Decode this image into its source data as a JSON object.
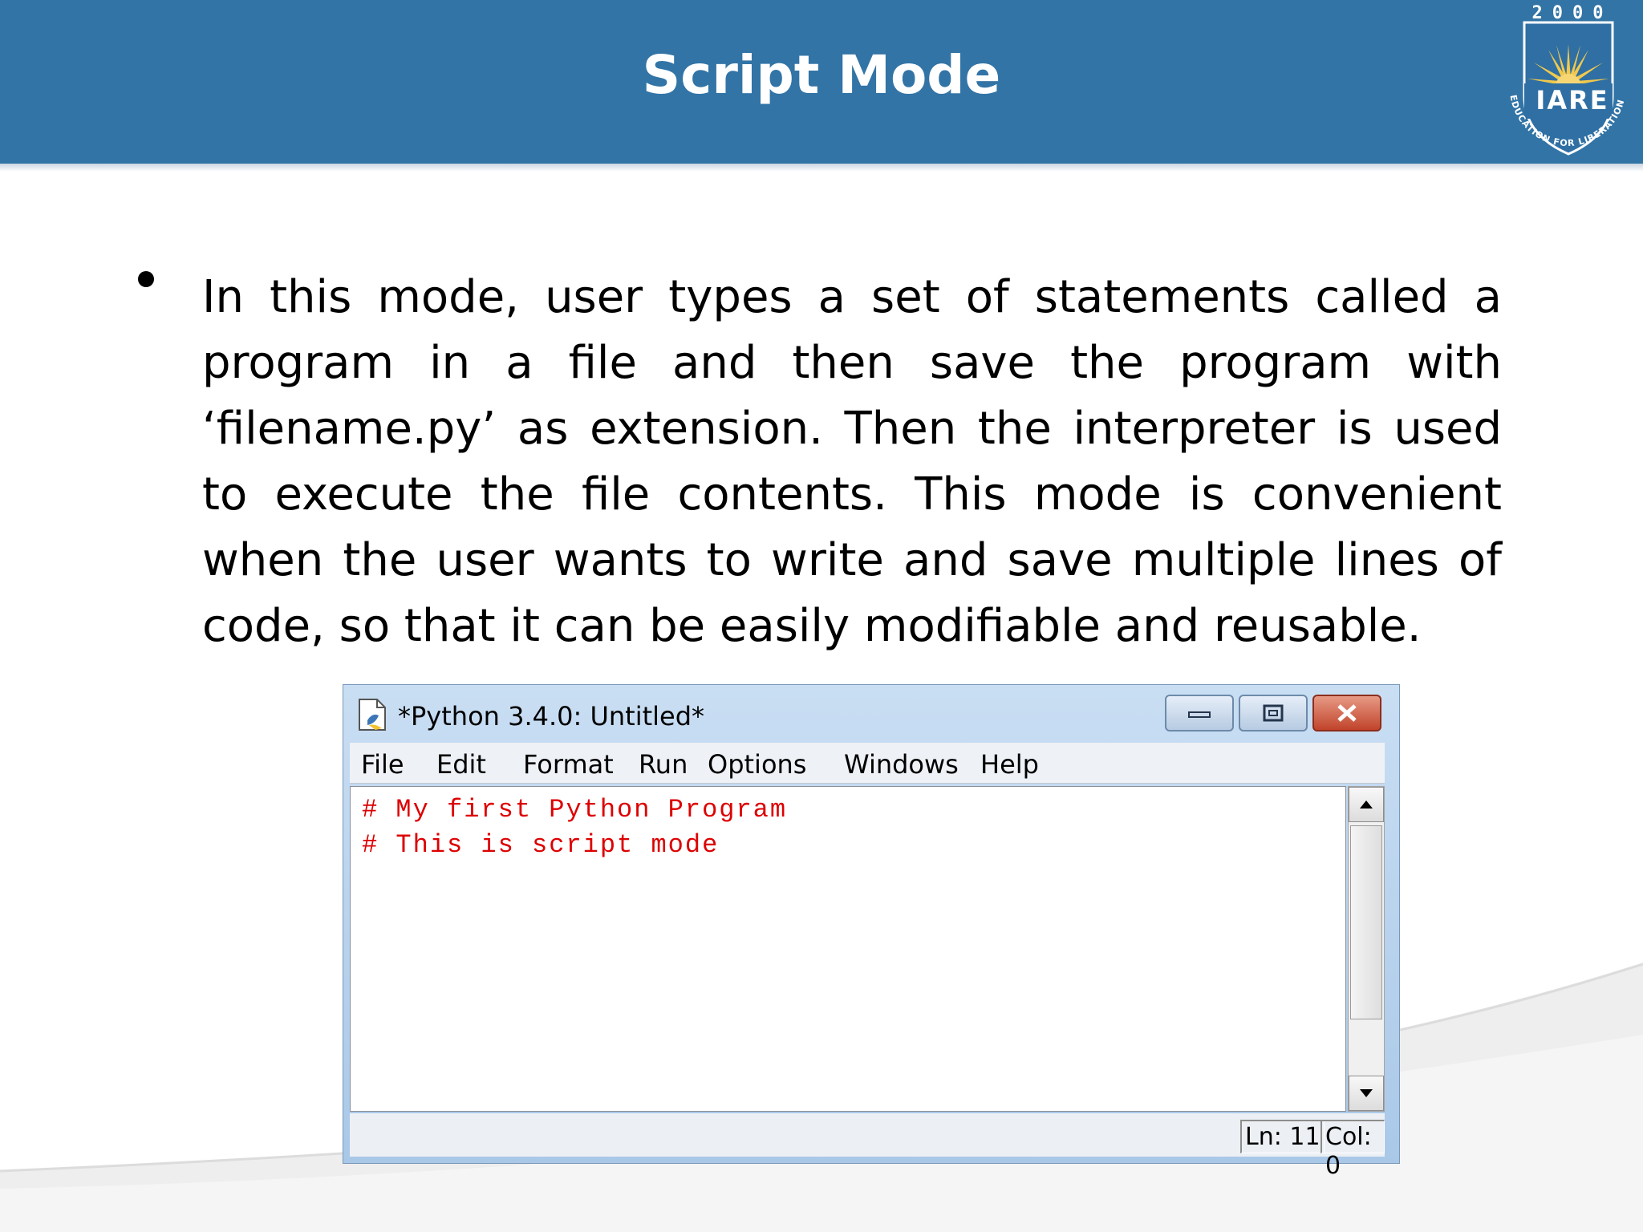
{
  "slide": {
    "title": "Script Mode",
    "logo": {
      "year": "2000",
      "name": "IARE",
      "motto": "EDUCATION FOR LIBERATION"
    },
    "bullet_text": "In this mode, user types a set of statements called a program in a file and then save the program with ‘filename.py’ as extension. Then the interpreter is used to execute the file contents. This mode is convenient when the user wants to write and save multiple lines of code, so that it can be easily modifiable and reusable."
  },
  "window": {
    "title": "*Python 3.4.0: Untitled*",
    "menu": [
      "File",
      "Edit",
      "Format",
      "Run",
      "Options",
      "Windows",
      "Help"
    ],
    "code_lines": [
      "# My first Python Program",
      "# This is script mode"
    ],
    "status": {
      "line": "Ln: 11",
      "col": "Col: 0"
    },
    "colors": {
      "comment": "#dd0000",
      "header": "#3274a6"
    }
  }
}
